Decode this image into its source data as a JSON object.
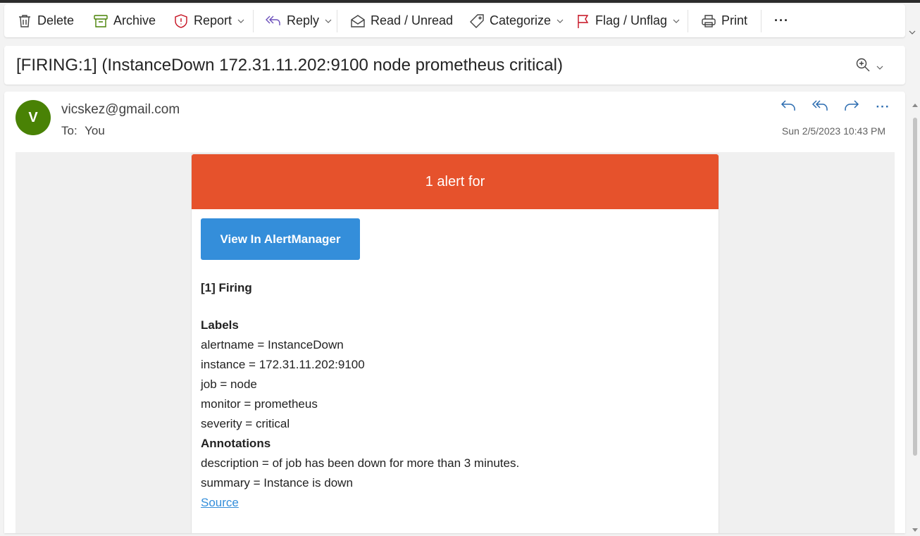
{
  "toolbar": {
    "delete": "Delete",
    "archive": "Archive",
    "report": "Report",
    "reply": "Reply",
    "read_unread": "Read / Unread",
    "categorize": "Categorize",
    "flag_unflag": "Flag / Unflag",
    "print": "Print",
    "more": "···"
  },
  "subject": "[FIRING:1] (InstanceDown 172.31.11.202:9100 node prometheus critical)",
  "message": {
    "avatar_initial": "V",
    "avatar_color": "#498205",
    "sender": "vicskez@gmail.com",
    "to_label": "To:",
    "to_value": "You",
    "date": "Sun 2/5/2023 10:43 PM",
    "more_actions": "···"
  },
  "email": {
    "header": "1 alert for",
    "header_color": "#e6522c",
    "button": "View In AlertManager",
    "button_color": "#348eda",
    "firing_title": "[1] Firing",
    "labels_heading": "Labels",
    "labels": [
      "alertname = InstanceDown",
      "instance = 172.31.11.202:9100",
      "job = node",
      "monitor = prometheus",
      "severity = critical"
    ],
    "annotations_heading": "Annotations",
    "annotations": [
      "description = of job has been down for more than 3 minutes.",
      "summary = Instance is down"
    ],
    "source_link": "Source"
  },
  "icons": {
    "delete": "trash-icon",
    "archive": "archive-box-icon",
    "report": "shield-alert-icon",
    "reply": "reply-all-icon",
    "read_unread": "envelope-open-icon",
    "categorize": "tag-icon",
    "flag": "flag-icon",
    "print": "printer-icon",
    "zoom": "zoom-in-icon"
  }
}
